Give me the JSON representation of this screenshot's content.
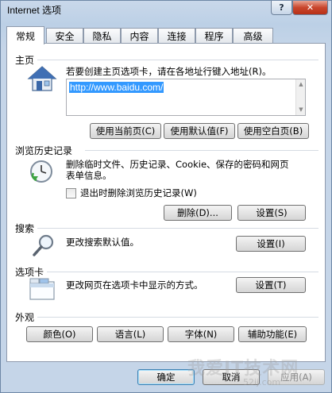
{
  "window": {
    "title": "Internet 选项",
    "help_glyph": "?",
    "close_glyph": "✕"
  },
  "tabs": [
    {
      "label": "常规",
      "active": true
    },
    {
      "label": "安全"
    },
    {
      "label": "隐私"
    },
    {
      "label": "内容"
    },
    {
      "label": "连接"
    },
    {
      "label": "程序"
    },
    {
      "label": "高级"
    }
  ],
  "home": {
    "title": "主页",
    "description": "若要创建主页选项卡，请在各地址行键入地址(R)。",
    "address": "http://www.baidu.com/",
    "buttons": [
      "使用当前页(C)",
      "使用默认值(F)",
      "使用空白页(B)"
    ]
  },
  "history": {
    "title": "浏览历史记录",
    "description_line1": "删除临时文件、历史记录、Cookie、保存的密码和网页",
    "description_line2": "表单信息。",
    "checkbox_label": "退出时删除浏览历史记录(W)",
    "delete_button": "删除(D)...",
    "settings_button": "设置(S)"
  },
  "search": {
    "title": "搜索",
    "description": "更改搜索默认值。",
    "settings_button": "设置(I)"
  },
  "tabs_section": {
    "title": "选项卡",
    "description": "更改网页在选项卡中显示的方式。",
    "settings_button": "设置(T)"
  },
  "appearance": {
    "title": "外观",
    "buttons": [
      "颜色(O)",
      "语言(L)",
      "字体(N)",
      "辅助功能(E)"
    ]
  },
  "footer": {
    "ok": "确定",
    "cancel": "取消",
    "apply": "应用(A)"
  },
  "watermark": {
    "text": "我爱IT技术网",
    "url": "52ij.com"
  }
}
